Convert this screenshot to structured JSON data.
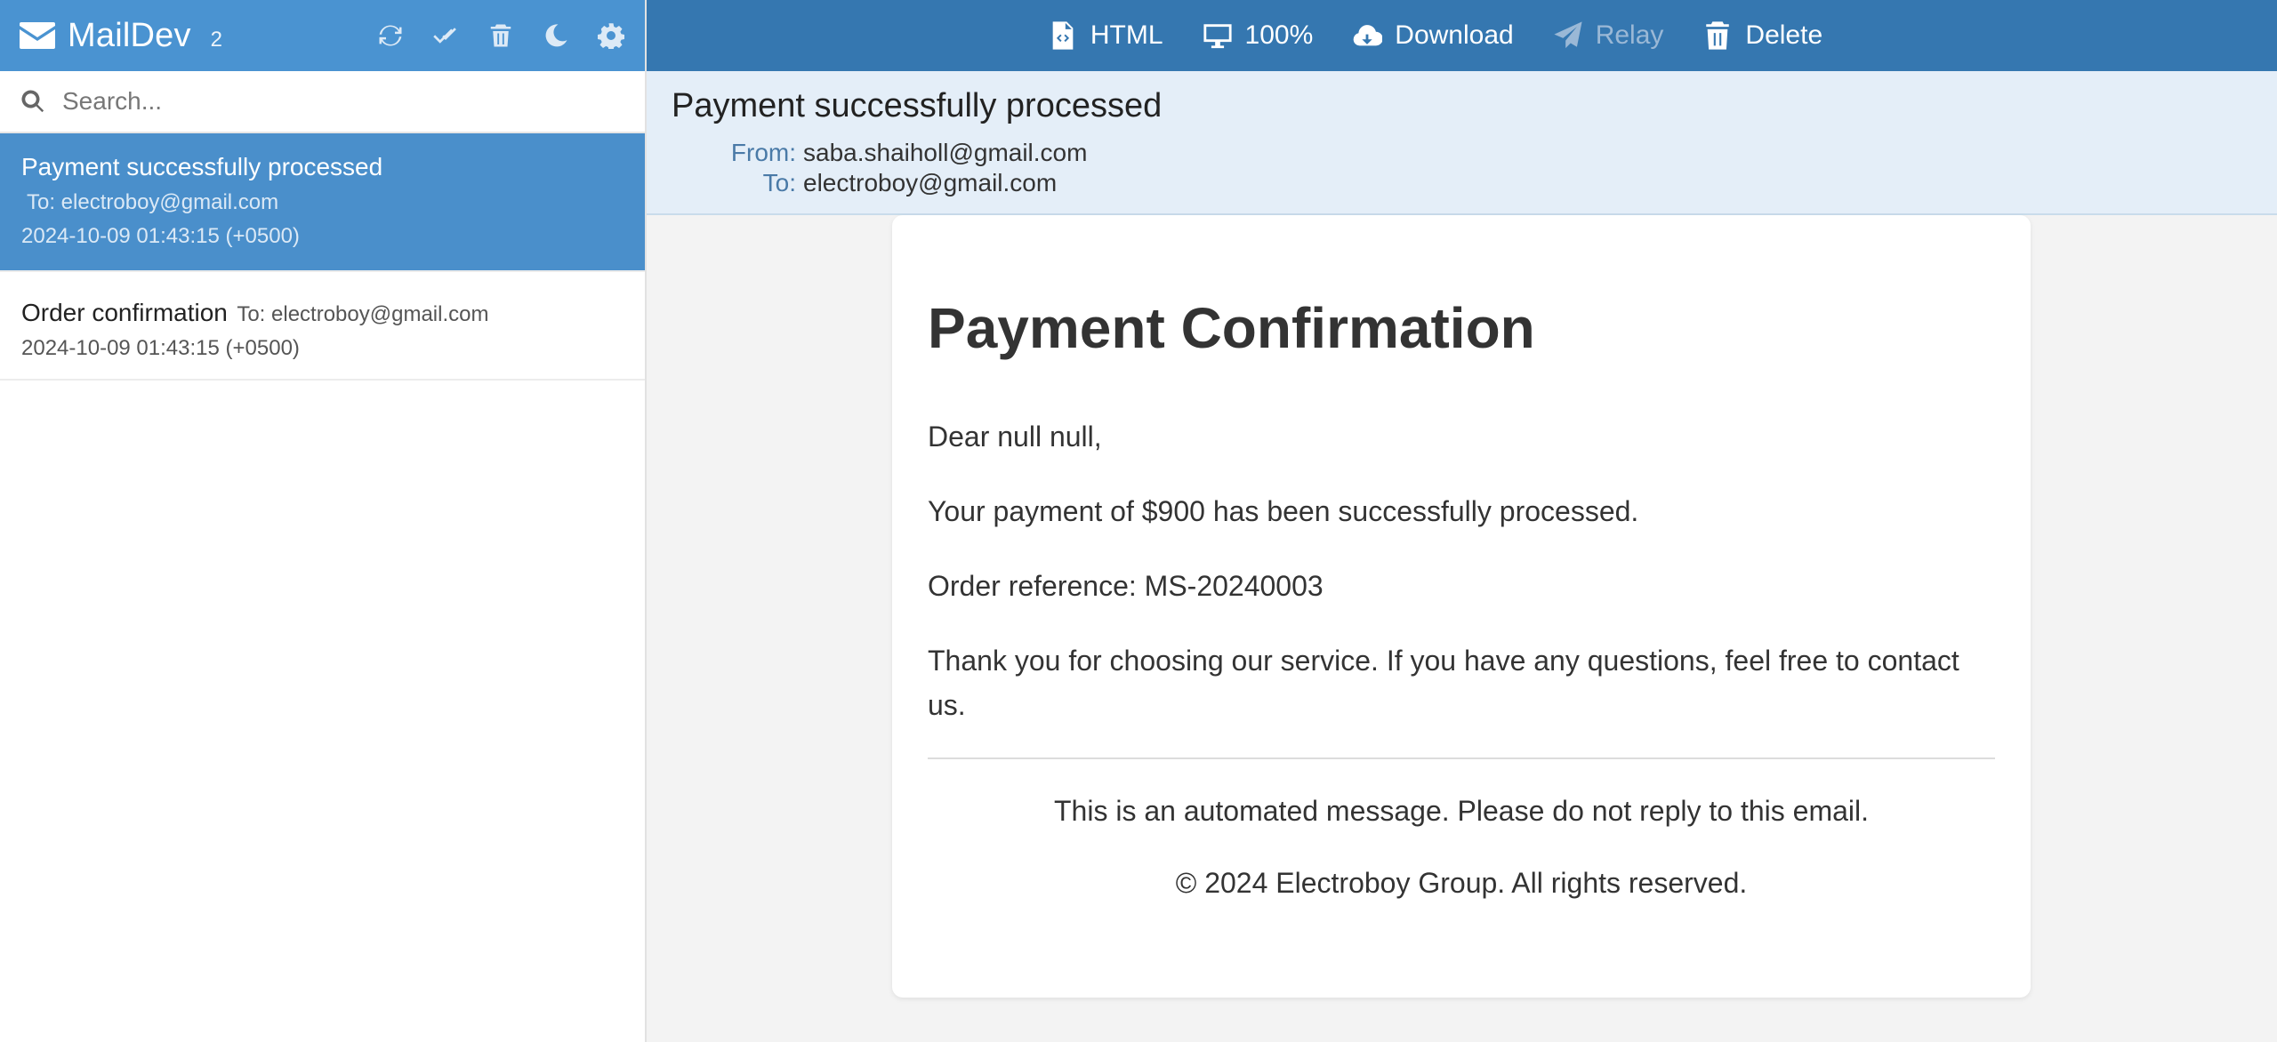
{
  "sidebar": {
    "brand": "MailDev",
    "count": "2",
    "search_placeholder": "Search..."
  },
  "messages": [
    {
      "subject": "Payment successfully processed",
      "to": "To: electroboy@gmail.com",
      "date": "2024-10-09 01:43:15 (+0500)",
      "selected": true
    },
    {
      "subject": "Order confirmation",
      "to": "To: electroboy@gmail.com",
      "date": "2024-10-09 01:43:15 (+0500)",
      "selected": false
    }
  ],
  "toolbar": {
    "html": "HTML",
    "zoom": "100%",
    "download": "Download",
    "relay": "Relay",
    "delete": "Delete"
  },
  "email": {
    "subject": "Payment successfully processed",
    "from_label": "From:",
    "from": "saba.shaiholl@gmail.com",
    "to_label": "To:",
    "to": "electroboy@gmail.com"
  },
  "content": {
    "heading": "Payment Confirmation",
    "greeting": "Dear null null,",
    "line1": "Your payment of $900 has been successfully processed.",
    "line2": "Order reference: MS-20240003",
    "line3": "Thank you for choosing our service. If you have any questions, feel free to contact us.",
    "footer1": "This is an automated message. Please do not reply to this email.",
    "footer2": "© 2024 Electroboy Group. All rights reserved."
  },
  "colors": {
    "sidebar_header": "#4a93d1",
    "toolbar": "#3577b0",
    "selected_item": "#4a8fcb",
    "header_bg": "#e4eef8"
  }
}
